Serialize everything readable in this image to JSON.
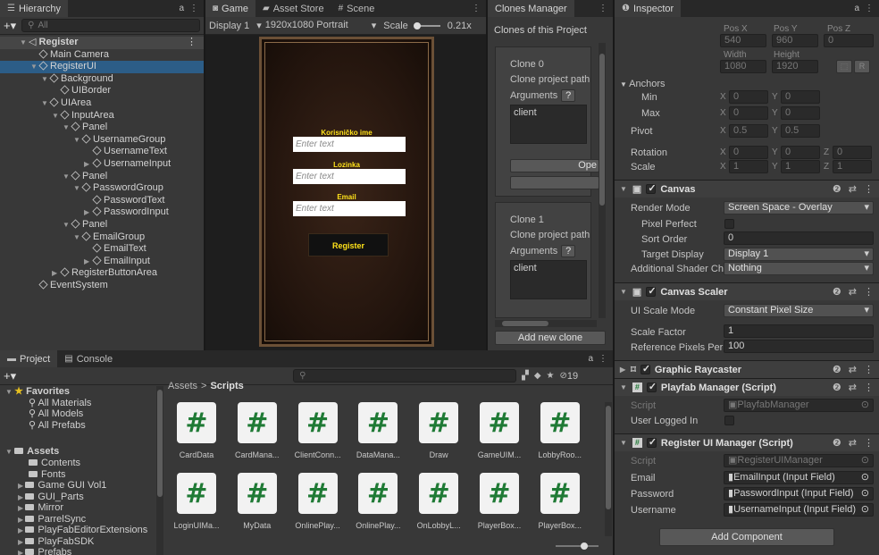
{
  "hierarchy": {
    "tab": "Hierarchy",
    "search_placeholder": "All",
    "items": [
      {
        "label": "Register",
        "depth": 0,
        "kind": "scene",
        "arrow": "▼"
      },
      {
        "label": "Main Camera",
        "depth": 1,
        "kind": "go",
        "arrow": ""
      },
      {
        "label": "RegisterUI",
        "depth": 1,
        "kind": "go",
        "arrow": "▼",
        "selected": true
      },
      {
        "label": "Background",
        "depth": 2,
        "kind": "go",
        "arrow": "▼"
      },
      {
        "label": "UIBorder",
        "depth": 3,
        "kind": "go",
        "arrow": ""
      },
      {
        "label": "UIArea",
        "depth": 2,
        "kind": "go",
        "arrow": "▼"
      },
      {
        "label": "InputArea",
        "depth": 3,
        "kind": "go",
        "arrow": "▼"
      },
      {
        "label": "Panel",
        "depth": 4,
        "kind": "go",
        "arrow": "▼"
      },
      {
        "label": "UsernameGroup",
        "depth": 5,
        "kind": "go",
        "arrow": "▼"
      },
      {
        "label": "UsernameText",
        "depth": 6,
        "kind": "go",
        "arrow": ""
      },
      {
        "label": "UsernameInput",
        "depth": 6,
        "kind": "go",
        "arrow": "▶"
      },
      {
        "label": "Panel",
        "depth": 4,
        "kind": "go",
        "arrow": "▼"
      },
      {
        "label": "PasswordGroup",
        "depth": 5,
        "kind": "go",
        "arrow": "▼"
      },
      {
        "label": "PasswordText",
        "depth": 6,
        "kind": "go",
        "arrow": ""
      },
      {
        "label": "PasswordInput",
        "depth": 6,
        "kind": "go",
        "arrow": "▶"
      },
      {
        "label": "Panel",
        "depth": 4,
        "kind": "go",
        "arrow": "▼"
      },
      {
        "label": "EmailGroup",
        "depth": 5,
        "kind": "go",
        "arrow": "▼"
      },
      {
        "label": "EmailText",
        "depth": 6,
        "kind": "go",
        "arrow": ""
      },
      {
        "label": "EmailInput",
        "depth": 6,
        "kind": "go",
        "arrow": "▶"
      },
      {
        "label": "RegisterButtonArea",
        "depth": 3,
        "kind": "go",
        "arrow": "▶"
      },
      {
        "label": "EventSystem",
        "depth": 1,
        "kind": "go",
        "arrow": ""
      }
    ]
  },
  "game": {
    "tabs": [
      "Game",
      "Asset Store",
      "Scene"
    ],
    "display": "Display 1",
    "resolution": "1920x1080 Portrait",
    "scale_label": "Scale",
    "scale_value": "0.21x",
    "screen": {
      "username_label": "Korisničko ime",
      "password_label": "Lozinka",
      "email_label": "Email",
      "placeholder": "Enter text",
      "register_button": "Register"
    }
  },
  "clones": {
    "tab": "Clones Manager",
    "header": "Clones of this Project",
    "project_path_label": "Clone project path",
    "arguments_label": "Arguments",
    "help": "?",
    "open_button": "Ope",
    "add_button": "Add new clone",
    "items": [
      {
        "name": "Clone 0",
        "args": "client"
      },
      {
        "name": "Clone 1",
        "args": "client"
      }
    ]
  },
  "inspector": {
    "tab": "Inspector",
    "rect": {
      "headers": [
        "Pos X",
        "Pos Y",
        "Pos Z"
      ],
      "values": [
        "540",
        "960",
        "0"
      ],
      "size_headers": [
        "Width",
        "Height"
      ],
      "size_values": [
        "1080",
        "1920"
      ],
      "r_button": "R"
    },
    "anchors": {
      "title": "Anchors",
      "min_label": "Min",
      "max_label": "Max",
      "min": [
        "0",
        "0"
      ],
      "max": [
        "0",
        "0"
      ]
    },
    "pivot": {
      "label": "Pivot",
      "values": [
        "0.5",
        "0.5"
      ]
    },
    "rotation": {
      "label": "Rotation",
      "values": [
        "0",
        "0",
        "0"
      ]
    },
    "scale": {
      "label": "Scale",
      "values": [
        "1",
        "1",
        "1"
      ]
    },
    "axes": [
      "X",
      "Y",
      "Z"
    ],
    "canvas": {
      "title": "Canvas",
      "render_mode_label": "Render Mode",
      "render_mode": "Screen Space - Overlay",
      "pixel_perfect_label": "Pixel Perfect",
      "sort_order_label": "Sort Order",
      "sort_order": "0",
      "target_display_label": "Target Display",
      "target_display": "Display 1",
      "shader_label": "Additional Shader Ch",
      "shader_value": "Nothing"
    },
    "scaler": {
      "title": "Canvas Scaler",
      "mode_label": "UI Scale Mode",
      "mode": "Constant Pixel Size",
      "factor_label": "Scale Factor",
      "factor": "1",
      "ref_label": "Reference Pixels Per",
      "ref": "100"
    },
    "raycaster": {
      "title": "Graphic Raycaster"
    },
    "playfab": {
      "title": "Playfab Manager (Script)",
      "script_label": "Script",
      "script": "PlayfabManager",
      "logged_label": "User Logged In"
    },
    "register": {
      "title": "Register UI Manager (Script)",
      "script_label": "Script",
      "script": "RegisterUIManager",
      "email_label": "Email",
      "email": "EmailInput (Input Field)",
      "password_label": "Password",
      "password": "PasswordInput (Input Field)",
      "username_label": "Username",
      "username": "UsernameInput (Input Field)"
    },
    "add_component": "Add Component"
  },
  "project": {
    "tabs": [
      "Project",
      "Console"
    ],
    "count": "19",
    "breadcrumb": [
      "Assets",
      "Scripts"
    ],
    "favorites": {
      "title": "Favorites",
      "items": [
        "All Materials",
        "All Models",
        "All Prefabs"
      ]
    },
    "assets": {
      "title": "Assets",
      "items": [
        "Contents",
        "Fonts",
        "Game GUI Vol1",
        "GUI_Parts",
        "Mirror",
        "ParrelSync",
        "PlayFabEditorExtensions",
        "PlayFabSDK",
        "Prefabs"
      ]
    },
    "scripts": [
      "CardData",
      "CardMana...",
      "ClientConn...",
      "DataMana...",
      "Draw",
      "GameUIM...",
      "LobbyRoo...",
      "LoginUIMa...",
      "MyData",
      "OnlinePlay...",
      "OnlinePlay...",
      "OnLobbyL...",
      "PlayerBox...",
      "PlayerBox..."
    ],
    "glyph": "#"
  },
  "colors": {
    "selection": "#2c5d87",
    "panel": "#383838",
    "script_green": "#1f7a35",
    "game_label": "#ffe21a"
  }
}
